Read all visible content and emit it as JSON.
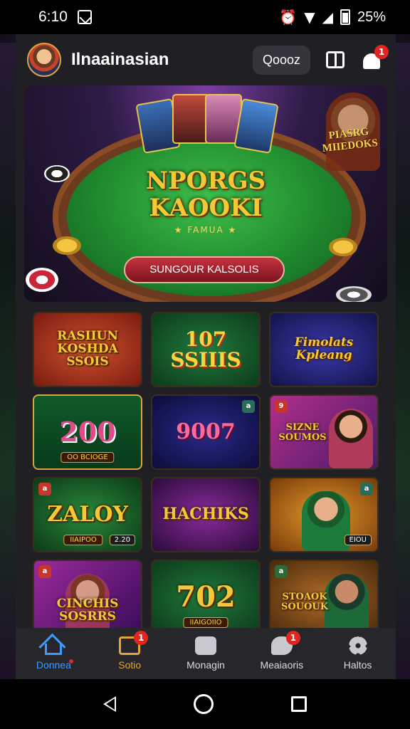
{
  "status_bar": {
    "time": "6:10",
    "battery": "25%"
  },
  "header": {
    "brand": "Ilnaainasian",
    "search_label": "Qoooz",
    "notification_count": "1"
  },
  "hero": {
    "title_line1": "NPORGS",
    "title_line2": "KAOOKI",
    "tagline": "★ FAMUA ★",
    "button_label": "SUNGOUR KALSOLIS",
    "side_text": "PIASRG MIIEDOKS"
  },
  "games": [
    {
      "title": "RASIIUN KOSHDA SSOIS",
      "theme": "red-gold"
    },
    {
      "title": "107 SSIIIS",
      "theme": "green"
    },
    {
      "title": "Fimolats Kpleang",
      "theme": "blue"
    },
    {
      "title": "200",
      "plate": "OO BCIOGE",
      "theme": "slot"
    },
    {
      "title": "9007",
      "corner": "a",
      "theme": "navy"
    },
    {
      "title": "SIZNE SOUMOS",
      "corner": "9",
      "theme": "purple-person"
    },
    {
      "title": "ZALOY",
      "plate": "IIAIPOO",
      "corner_value": "2.20",
      "corner": "a",
      "theme": "green-gold"
    },
    {
      "title": "HACHIKS",
      "theme": "purple-gold"
    },
    {
      "title": "",
      "plate": "EIOU",
      "corner": "a",
      "theme": "orange-person"
    },
    {
      "title": "CINCHIS SOSRRS",
      "corner": "a",
      "theme": "purple-person2"
    },
    {
      "title": "702",
      "plate": "IIAIGOIIO",
      "theme": "green2"
    },
    {
      "title": "STOAOK SOUOUK",
      "corner": "a",
      "theme": "brown-person"
    }
  ],
  "bottom_nav": [
    {
      "label": "Donnea",
      "icon": "home-icon",
      "badge": ""
    },
    {
      "label": "Sotio",
      "icon": "promo-icon",
      "badge": "1"
    },
    {
      "label": "Monagin",
      "icon": "bag-icon",
      "badge": ""
    },
    {
      "label": "Meaiaoris",
      "icon": "chat-icon",
      "badge": "1"
    },
    {
      "label": "Haltos",
      "icon": "gear-icon",
      "badge": ""
    }
  ],
  "colors": {
    "accent": "#3d9bff",
    "promo": "#e6a33a",
    "badge": "#e2261f",
    "gold": "#f6c836"
  }
}
